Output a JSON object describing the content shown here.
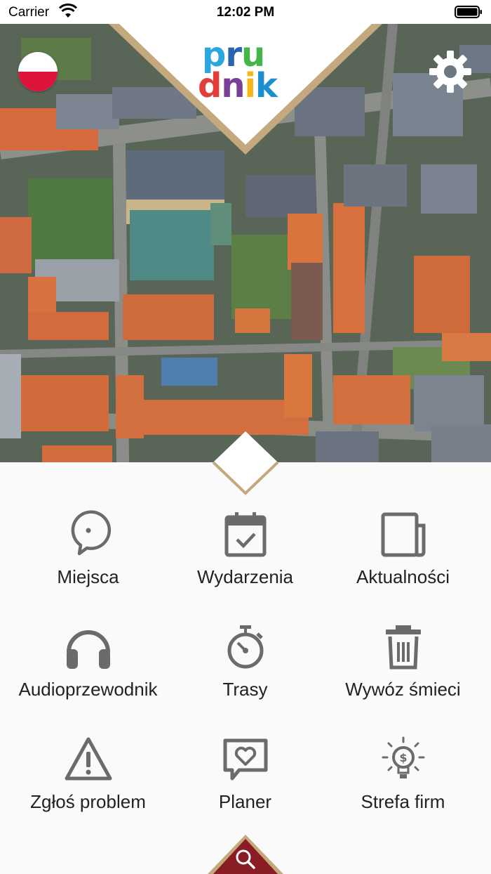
{
  "status_bar": {
    "carrier": "Carrier",
    "time": "12:02 PM"
  },
  "header": {
    "language_flag": "Polish flag",
    "settings_icon": "gear-icon",
    "logo": {
      "line1": [
        "p",
        "r",
        "u"
      ],
      "line2": [
        "d",
        "n",
        "i",
        "k"
      ],
      "line1_colors": [
        "#2ca6df",
        "#2a63b0",
        "#44b649"
      ],
      "line2_colors": [
        "#e33f3a",
        "#7a3f96",
        "#f5b81b",
        "#1d8fd1"
      ]
    }
  },
  "menu": [
    {
      "label": "Miejsca",
      "icon": "map-pin-icon"
    },
    {
      "label": "Wydarzenia",
      "icon": "calendar-check-icon"
    },
    {
      "label": "Aktualności",
      "icon": "newspaper-icon"
    },
    {
      "label": "Audioprzewodnik",
      "icon": "headphones-icon"
    },
    {
      "label": "Trasy",
      "icon": "stopwatch-icon"
    },
    {
      "label": "Wywóz śmieci",
      "icon": "trash-icon"
    },
    {
      "label": "Zgłoś problem",
      "icon": "warning-icon"
    },
    {
      "label": "Planer",
      "icon": "heart-message-icon"
    },
    {
      "label": "Strefa firm",
      "icon": "lightbulb-dollar-icon"
    }
  ],
  "footer": {
    "search_icon": "search-icon"
  },
  "colors": {
    "accent_gold": "#c4a97e",
    "search_tab": "#8a1c26",
    "icon_gray": "#6b6b6b"
  }
}
